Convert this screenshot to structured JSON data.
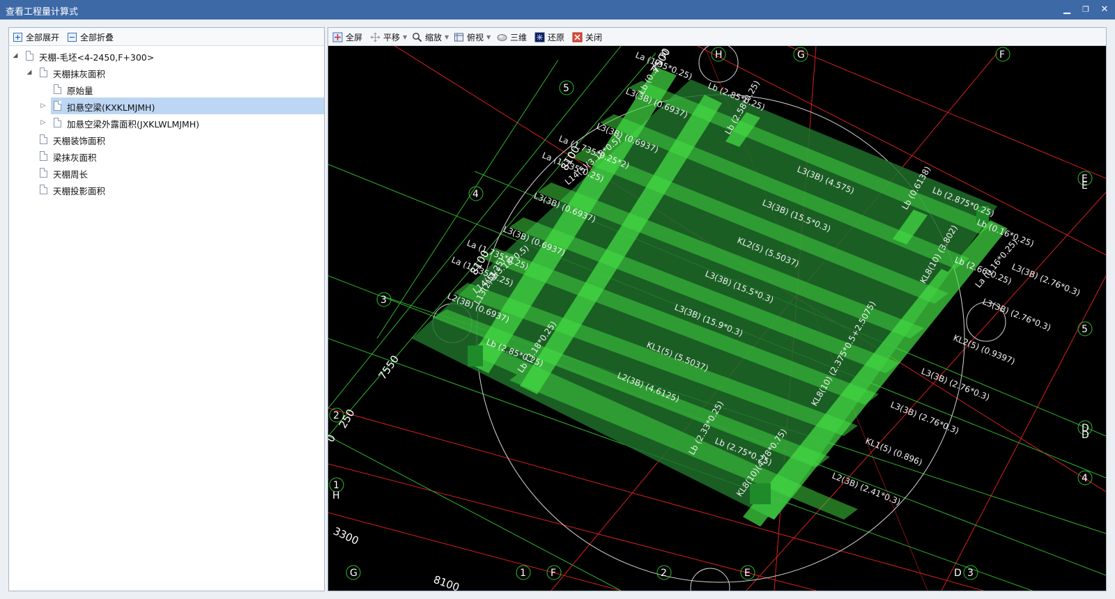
{
  "window": {
    "title": "查看工程量计算式",
    "min_label": "▁",
    "max_label": "❐",
    "close_label": "✕"
  },
  "tree_toolbar": {
    "expand_all": "全部展开",
    "collapse_all": "全部折叠"
  },
  "tree": {
    "items": [
      {
        "label": "天棚-毛坯<4-2450,F+300>"
      },
      {
        "label": "天棚抹灰面积"
      },
      {
        "label": "原始量"
      },
      {
        "label": "扣悬空梁(KXKLMJMH)"
      },
      {
        "label": "加悬空梁外露面积(JXKLWLMJMH)"
      },
      {
        "label": "天棚装饰面积"
      },
      {
        "label": "梁抹灰面积"
      },
      {
        "label": "天棚周长"
      },
      {
        "label": "天棚投影面积"
      }
    ]
  },
  "view_toolbar": {
    "full_screen": "全屏",
    "pan": "平移",
    "zoom": "缩放",
    "top_view": "俯视",
    "three_d": "三维",
    "restore": "还原",
    "close": "关闭"
  },
  "colors": {
    "titlebar": "#3d69a7",
    "selected_row": "#bcd6f4",
    "beam": "#33cc33",
    "grid_red": "#e02020",
    "grid_green": "#2fbf2f"
  },
  "drawing": {
    "axes": {
      "H_top": "H",
      "G_top": "G",
      "F_top": "F",
      "E_right": "E",
      "E_right2": "E",
      "D_right": "D",
      "five_left": "5",
      "four_left": "4",
      "three_left": "3",
      "two_left": "2",
      "one_left": "1",
      "H_left": "H",
      "G_bottom": "G",
      "one_bottom": "1",
      "F_bottom": "F",
      "two_bottom": "2",
      "E_bottom": "E",
      "D_bottom": "D",
      "three_bottom": "3",
      "five_right": "5",
      "four_right": "4",
      "D_right2": "D"
    },
    "dimensions": {
      "d7500": "7500",
      "d8100a": "8100",
      "d8100b": "8100",
      "d7550": "7550",
      "d250": "250",
      "d3300": "3300",
      "d8100c": "8100",
      "d0": "0"
    },
    "beam_labels": [
      "La (1.35*0.25)",
      "Lb (0.3*0.3)",
      "L3(3B) (0.6937)",
      "Lb (2.85*0.25)",
      "Lb (2.58*0.25)",
      "L3(3B) (0.6937)",
      "La (1.735*0.25*2)",
      "La (1.735*0.25)",
      "L14(5)(3.18*0.5)",
      "L3(3B) (4.575)",
      "L3(3B) (0.6937)",
      "L3(3B) (15.5*0.3)",
      "Lb (0.6138)",
      "Lb (2.875*0.25)",
      "KL2(5) (5.5037)",
      "L3(3B) (0.6937)",
      "La (1.735*0.25)",
      "La (1.735*0.25)",
      "L14(5)(3.18*0.5)",
      "L13(2)(3.25)",
      "L3(3B) (15.5*0.3)",
      "KL8(10) (3.802)",
      "Lb (2.66*0.25)",
      "Lb (0.16*0.25)",
      "La (0.16*0.25)",
      "L3(3B) (2.76*0.3)",
      "L2(3B) (0.6937)",
      "L3(3B) (15.9*0.3)",
      "L3(3B) (2.76*0.3)",
      "Lb (2.85*0.25)",
      "Lb (3.18*0.25)",
      "KL1(5) (5.5037)",
      "KL2(5) (0.9397)",
      "KL8(10) (2.375*0.5+2.5075)",
      "L3(3B) (2.76*0.3)",
      "L2(3B) (4.6125)",
      "L3(3B) (2.76*0.3)",
      "Lb (2.33*0.25)",
      "Lb (2.75*0.25)",
      "KL1(5) (0.896)",
      "KL8(10)(4.78*0.75)",
      "L2(3B) (2.41*0.3)"
    ]
  }
}
